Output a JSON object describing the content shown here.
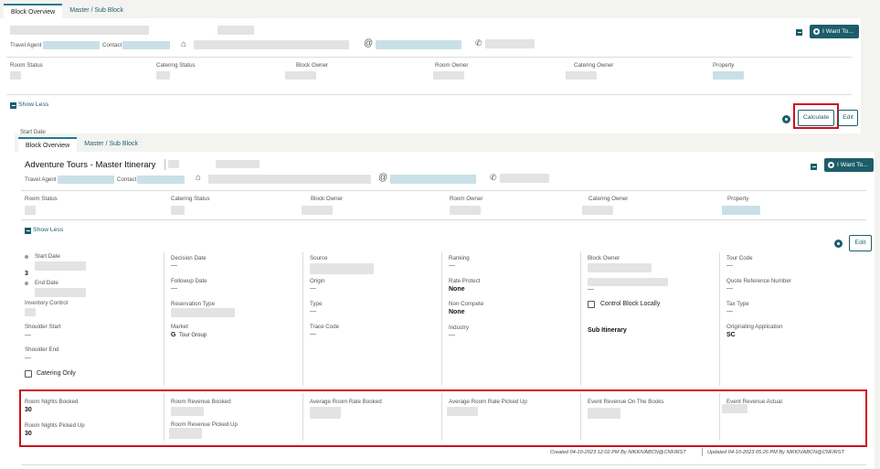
{
  "back_panel": {
    "tabs": [
      "Block Overview",
      "Master / Sub Block"
    ],
    "travel_agent_label": "Travel Agent",
    "contact_label": "Contact",
    "i_want_to": "I Want To...",
    "status_labels": [
      "Room Status",
      "Catering Status",
      "Block Owner",
      "Room Owner",
      "Catering Owner",
      "Property"
    ],
    "show_less": "Show Less",
    "start_date_label": "Start Date",
    "calculate_button": "Calculate",
    "edit_button": "Edit"
  },
  "front_panel": {
    "tabs": [
      "Block Overview",
      "Master / Sub Block"
    ],
    "title": "Adventure Tours - Master Itinerary",
    "travel_agent_label": "Travel Agent",
    "contact_label": "Contact",
    "i_want_to": "I Want To...",
    "status_labels": [
      "Room Status",
      "Catering Status",
      "Block Owner",
      "Room Owner",
      "Catering Owner",
      "Property"
    ],
    "show_less": "Show Less",
    "edit_button": "Edit",
    "col1": {
      "start_date": "Start Date",
      "nights": "3",
      "end_date": "End Date",
      "inventory_control": "Inventory Control",
      "shoulder_start": "Shoulder Start",
      "shoulder_start_value": "—",
      "shoulder_end": "Shoulder End",
      "shoulder_end_value": "—",
      "catering_only": "Catering Only"
    },
    "col2": {
      "decision_date": "Decision Date",
      "decision_date_value": "—",
      "followup_date": "Followup Date",
      "followup_date_value": "—",
      "reservation_type": "Reservation Type",
      "market": "Market",
      "market_code": "G",
      "market_value": "Tour Group"
    },
    "col3": {
      "source": "Source",
      "origin": "Origin",
      "origin_value": "—",
      "type": "Type",
      "type_value": "—",
      "trace_code": "Trace Code",
      "trace_code_value": "—"
    },
    "col4": {
      "ranking": "Ranking",
      "ranking_value": "—",
      "rate_protect": "Rate Protect",
      "rate_protect_value": "None",
      "non_compete": "Non Compete",
      "non_compete_value": "None",
      "industry": "Industry",
      "industry_value": "—"
    },
    "col5": {
      "block_owner": "Block Owner",
      "block_owner_dash": "—",
      "control_block_locally": "Control Block Locally",
      "sub_itinerary": "Sub Itinerary"
    },
    "col6": {
      "tour_code": "Tour Code",
      "tour_code_value": "—",
      "quote_reference_number": "Quote Reference Number",
      "quote_reference_value": "—",
      "tax_type": "Tax Type",
      "tax_type_value": "—",
      "originating_application": "Originating Application",
      "originating_application_value": "SC"
    },
    "revenue": {
      "room_nights_booked": "Room Nights Booked",
      "room_nights_booked_value": "30",
      "room_nights_picked_up": "Room Nights Picked Up",
      "room_nights_picked_up_value": "30",
      "room_revenue_booked": "Room Revenue Booked",
      "room_revenue_picked_up": "Room Revenue Picked Up",
      "average_room_rate_booked": "Average Room Rate Booked",
      "average_room_rate_picked_up": "Average Room Rate Picked Up",
      "event_revenue_on_the_books": "Event Revenue On The Books",
      "event_revenue_actual": "Event Revenue Actual"
    },
    "footer": {
      "created": "Created 04-10-2023 12:02 PM By NIKKIVABCN@CNFIRST",
      "updated": "Updated 04-10-2023 05:26 PM By NIKKIVABCN@CNFIRST"
    }
  },
  "colors": {
    "accent": "#1d5d6a",
    "highlight_red": "#d0101a",
    "page_bg": "#f3f3ef"
  }
}
